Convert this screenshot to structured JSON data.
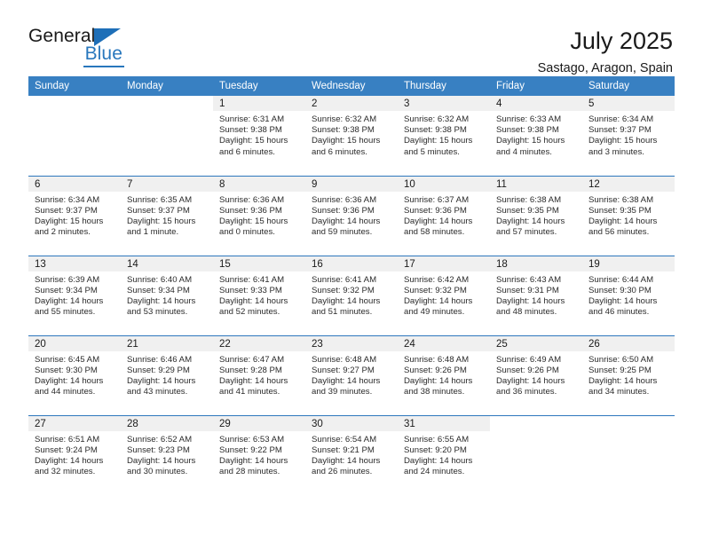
{
  "brand": {
    "name_part1": "General",
    "name_part2": "Blue"
  },
  "header": {
    "title": "July 2025",
    "location": "Sastago, Aragon, Spain"
  },
  "colors": {
    "header_blue": "#3880c2",
    "row_divider_blue": "#2e77bd",
    "daynum_band": "#f0f0f0",
    "brand_blue": "#2877bd",
    "text": "#1a1a1a"
  },
  "weekdays": [
    "Sunday",
    "Monday",
    "Tuesday",
    "Wednesday",
    "Thursday",
    "Friday",
    "Saturday"
  ],
  "labels": {
    "sunrise_prefix": "Sunrise:",
    "sunset_prefix": "Sunset:",
    "daylight_prefix": "Daylight:"
  },
  "weeks": [
    [
      {
        "day": "",
        "empty": true,
        "sunrise": "",
        "sunset": "",
        "daylight_line1": "",
        "daylight_line2": ""
      },
      {
        "day": "",
        "empty": true,
        "sunrise": "",
        "sunset": "",
        "daylight_line1": "",
        "daylight_line2": ""
      },
      {
        "day": "1",
        "sunrise": "Sunrise: 6:31 AM",
        "sunset": "Sunset: 9:38 PM",
        "daylight_line1": "Daylight: 15 hours",
        "daylight_line2": "and 6 minutes."
      },
      {
        "day": "2",
        "sunrise": "Sunrise: 6:32 AM",
        "sunset": "Sunset: 9:38 PM",
        "daylight_line1": "Daylight: 15 hours",
        "daylight_line2": "and 6 minutes."
      },
      {
        "day": "3",
        "sunrise": "Sunrise: 6:32 AM",
        "sunset": "Sunset: 9:38 PM",
        "daylight_line1": "Daylight: 15 hours",
        "daylight_line2": "and 5 minutes."
      },
      {
        "day": "4",
        "sunrise": "Sunrise: 6:33 AM",
        "sunset": "Sunset: 9:38 PM",
        "daylight_line1": "Daylight: 15 hours",
        "daylight_line2": "and 4 minutes."
      },
      {
        "day": "5",
        "sunrise": "Sunrise: 6:34 AM",
        "sunset": "Sunset: 9:37 PM",
        "daylight_line1": "Daylight: 15 hours",
        "daylight_line2": "and 3 minutes."
      }
    ],
    [
      {
        "day": "6",
        "sunrise": "Sunrise: 6:34 AM",
        "sunset": "Sunset: 9:37 PM",
        "daylight_line1": "Daylight: 15 hours",
        "daylight_line2": "and 2 minutes."
      },
      {
        "day": "7",
        "sunrise": "Sunrise: 6:35 AM",
        "sunset": "Sunset: 9:37 PM",
        "daylight_line1": "Daylight: 15 hours",
        "daylight_line2": "and 1 minute."
      },
      {
        "day": "8",
        "sunrise": "Sunrise: 6:36 AM",
        "sunset": "Sunset: 9:36 PM",
        "daylight_line1": "Daylight: 15 hours",
        "daylight_line2": "and 0 minutes."
      },
      {
        "day": "9",
        "sunrise": "Sunrise: 6:36 AM",
        "sunset": "Sunset: 9:36 PM",
        "daylight_line1": "Daylight: 14 hours",
        "daylight_line2": "and 59 minutes."
      },
      {
        "day": "10",
        "sunrise": "Sunrise: 6:37 AM",
        "sunset": "Sunset: 9:36 PM",
        "daylight_line1": "Daylight: 14 hours",
        "daylight_line2": "and 58 minutes."
      },
      {
        "day": "11",
        "sunrise": "Sunrise: 6:38 AM",
        "sunset": "Sunset: 9:35 PM",
        "daylight_line1": "Daylight: 14 hours",
        "daylight_line2": "and 57 minutes."
      },
      {
        "day": "12",
        "sunrise": "Sunrise: 6:38 AM",
        "sunset": "Sunset: 9:35 PM",
        "daylight_line1": "Daylight: 14 hours",
        "daylight_line2": "and 56 minutes."
      }
    ],
    [
      {
        "day": "13",
        "sunrise": "Sunrise: 6:39 AM",
        "sunset": "Sunset: 9:34 PM",
        "daylight_line1": "Daylight: 14 hours",
        "daylight_line2": "and 55 minutes."
      },
      {
        "day": "14",
        "sunrise": "Sunrise: 6:40 AM",
        "sunset": "Sunset: 9:34 PM",
        "daylight_line1": "Daylight: 14 hours",
        "daylight_line2": "and 53 minutes."
      },
      {
        "day": "15",
        "sunrise": "Sunrise: 6:41 AM",
        "sunset": "Sunset: 9:33 PM",
        "daylight_line1": "Daylight: 14 hours",
        "daylight_line2": "and 52 minutes."
      },
      {
        "day": "16",
        "sunrise": "Sunrise: 6:41 AM",
        "sunset": "Sunset: 9:32 PM",
        "daylight_line1": "Daylight: 14 hours",
        "daylight_line2": "and 51 minutes."
      },
      {
        "day": "17",
        "sunrise": "Sunrise: 6:42 AM",
        "sunset": "Sunset: 9:32 PM",
        "daylight_line1": "Daylight: 14 hours",
        "daylight_line2": "and 49 minutes."
      },
      {
        "day": "18",
        "sunrise": "Sunrise: 6:43 AM",
        "sunset": "Sunset: 9:31 PM",
        "daylight_line1": "Daylight: 14 hours",
        "daylight_line2": "and 48 minutes."
      },
      {
        "day": "19",
        "sunrise": "Sunrise: 6:44 AM",
        "sunset": "Sunset: 9:30 PM",
        "daylight_line1": "Daylight: 14 hours",
        "daylight_line2": "and 46 minutes."
      }
    ],
    [
      {
        "day": "20",
        "sunrise": "Sunrise: 6:45 AM",
        "sunset": "Sunset: 9:30 PM",
        "daylight_line1": "Daylight: 14 hours",
        "daylight_line2": "and 44 minutes."
      },
      {
        "day": "21",
        "sunrise": "Sunrise: 6:46 AM",
        "sunset": "Sunset: 9:29 PM",
        "daylight_line1": "Daylight: 14 hours",
        "daylight_line2": "and 43 minutes."
      },
      {
        "day": "22",
        "sunrise": "Sunrise: 6:47 AM",
        "sunset": "Sunset: 9:28 PM",
        "daylight_line1": "Daylight: 14 hours",
        "daylight_line2": "and 41 minutes."
      },
      {
        "day": "23",
        "sunrise": "Sunrise: 6:48 AM",
        "sunset": "Sunset: 9:27 PM",
        "daylight_line1": "Daylight: 14 hours",
        "daylight_line2": "and 39 minutes."
      },
      {
        "day": "24",
        "sunrise": "Sunrise: 6:48 AM",
        "sunset": "Sunset: 9:26 PM",
        "daylight_line1": "Daylight: 14 hours",
        "daylight_line2": "and 38 minutes."
      },
      {
        "day": "25",
        "sunrise": "Sunrise: 6:49 AM",
        "sunset": "Sunset: 9:26 PM",
        "daylight_line1": "Daylight: 14 hours",
        "daylight_line2": "and 36 minutes."
      },
      {
        "day": "26",
        "sunrise": "Sunrise: 6:50 AM",
        "sunset": "Sunset: 9:25 PM",
        "daylight_line1": "Daylight: 14 hours",
        "daylight_line2": "and 34 minutes."
      }
    ],
    [
      {
        "day": "27",
        "sunrise": "Sunrise: 6:51 AM",
        "sunset": "Sunset: 9:24 PM",
        "daylight_line1": "Daylight: 14 hours",
        "daylight_line2": "and 32 minutes."
      },
      {
        "day": "28",
        "sunrise": "Sunrise: 6:52 AM",
        "sunset": "Sunset: 9:23 PM",
        "daylight_line1": "Daylight: 14 hours",
        "daylight_line2": "and 30 minutes."
      },
      {
        "day": "29",
        "sunrise": "Sunrise: 6:53 AM",
        "sunset": "Sunset: 9:22 PM",
        "daylight_line1": "Daylight: 14 hours",
        "daylight_line2": "and 28 minutes."
      },
      {
        "day": "30",
        "sunrise": "Sunrise: 6:54 AM",
        "sunset": "Sunset: 9:21 PM",
        "daylight_line1": "Daylight: 14 hours",
        "daylight_line2": "and 26 minutes."
      },
      {
        "day": "31",
        "sunrise": "Sunrise: 6:55 AM",
        "sunset": "Sunset: 9:20 PM",
        "daylight_line1": "Daylight: 14 hours",
        "daylight_line2": "and 24 minutes."
      },
      {
        "day": "",
        "empty": true,
        "sunrise": "",
        "sunset": "",
        "daylight_line1": "",
        "daylight_line2": ""
      },
      {
        "day": "",
        "empty": true,
        "sunrise": "",
        "sunset": "",
        "daylight_line1": "",
        "daylight_line2": ""
      }
    ]
  ]
}
